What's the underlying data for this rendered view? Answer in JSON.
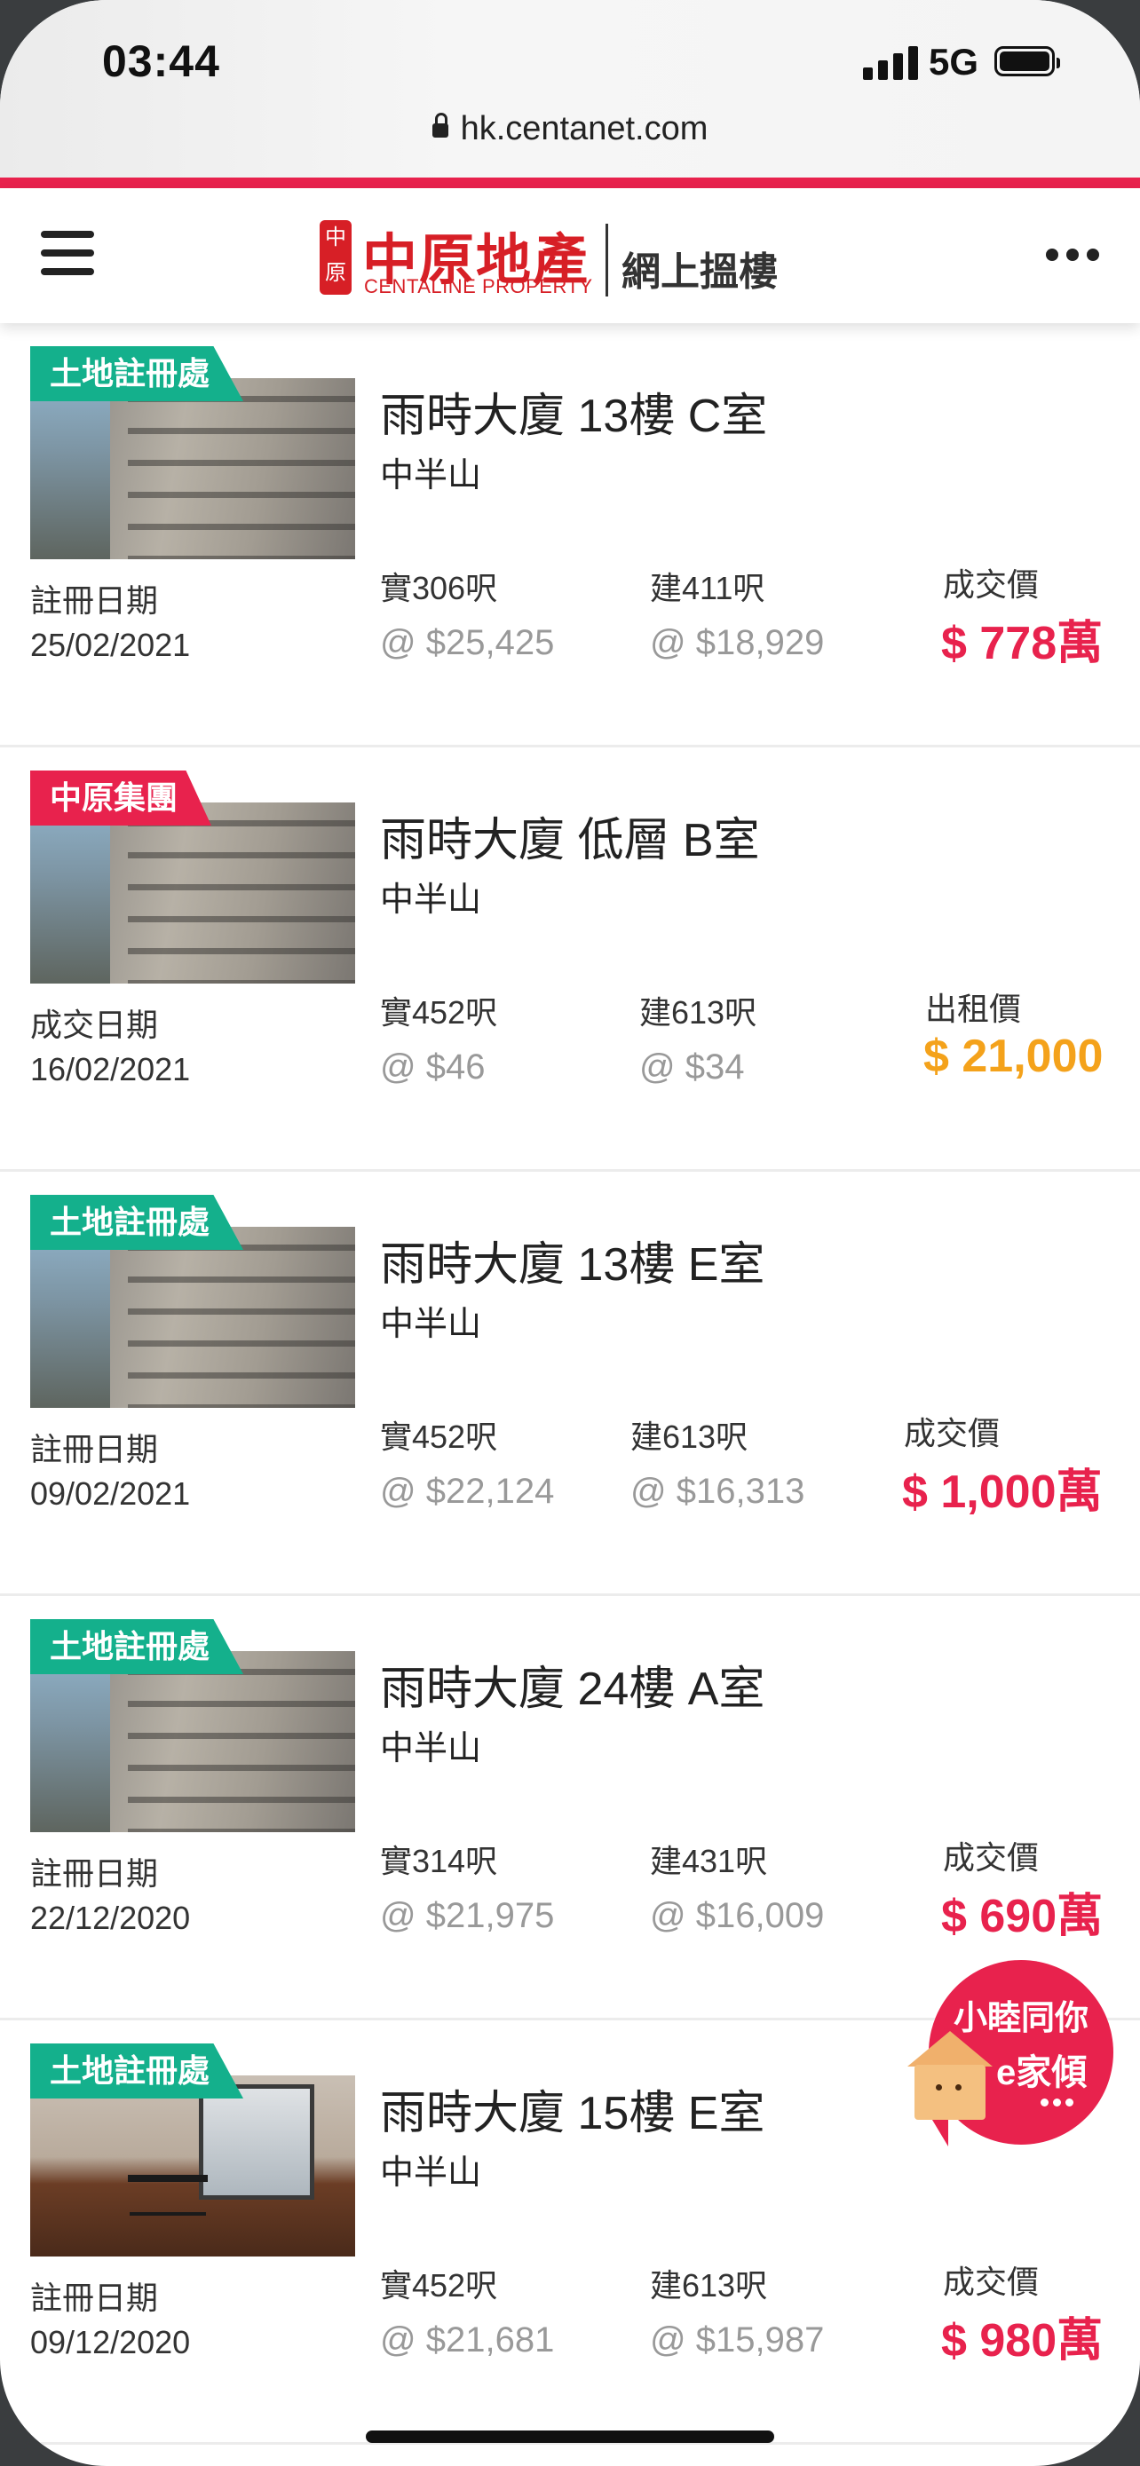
{
  "status_bar": {
    "time": "03:44",
    "network": "5G"
  },
  "browser": {
    "url": "hk.centanet.com"
  },
  "header": {
    "logo_seal": "中原",
    "logo_cn": "中原地產",
    "logo_en": "CENTALINE PROPERTY",
    "slogan": "網上搵樓"
  },
  "listings": [
    {
      "badge": "土地註冊處",
      "badge_color": "#14b08c",
      "title": "雨時大廈 13樓 C室",
      "district": "中半山",
      "date_label": "註冊日期",
      "date": "25/02/2021",
      "saleable": "實306呎",
      "saleable_unit_price": "@ $25,425",
      "gross": "建411呎",
      "gross_unit_price": "@ $18,929",
      "price_label": "成交價",
      "price": "$ 778萬",
      "price_color": "#e8224d",
      "photo": "building"
    },
    {
      "badge": "中原集團",
      "badge_color": "#e8224d",
      "title": "雨時大廈 低層 B室",
      "district": "中半山",
      "date_label": "成交日期",
      "date": "16/02/2021",
      "saleable": "實452呎",
      "saleable_unit_price": "@ $46",
      "gross": "建613呎",
      "gross_unit_price": "@ $34",
      "price_label": "出租價",
      "price": "$ 21,000",
      "price_color": "#f4a21b",
      "photo": "building"
    },
    {
      "badge": "土地註冊處",
      "badge_color": "#14b08c",
      "title": "雨時大廈 13樓 E室",
      "district": "中半山",
      "date_label": "註冊日期",
      "date": "09/02/2021",
      "saleable": "實452呎",
      "saleable_unit_price": "@ $22,124",
      "gross": "建613呎",
      "gross_unit_price": "@ $16,313",
      "price_label": "成交價",
      "price": "$ 1,000萬",
      "price_color": "#e8224d",
      "photo": "building"
    },
    {
      "badge": "土地註冊處",
      "badge_color": "#14b08c",
      "title": "雨時大廈 24樓 A室",
      "district": "中半山",
      "date_label": "註冊日期",
      "date": "22/12/2020",
      "saleable": "實314呎",
      "saleable_unit_price": "@ $21,975",
      "gross": "建431呎",
      "gross_unit_price": "@ $16,009",
      "price_label": "成交價",
      "price": "$ 690萬",
      "price_color": "#e8224d",
      "photo": "building"
    },
    {
      "badge": "土地註冊處",
      "badge_color": "#14b08c",
      "title": "雨時大廈 15樓 E室",
      "district": "中半山",
      "date_label": "註冊日期",
      "date": "09/12/2020",
      "saleable": "實452呎",
      "saleable_unit_price": "@ $21,681",
      "gross": "建613呎",
      "gross_unit_price": "@ $15,987",
      "price_label": "成交價",
      "price": "$ 980萬",
      "price_color": "#e8224d",
      "photo": "interior"
    }
  ],
  "chat_widget": {
    "line1": "小睦同你",
    "line2": "e家傾"
  }
}
